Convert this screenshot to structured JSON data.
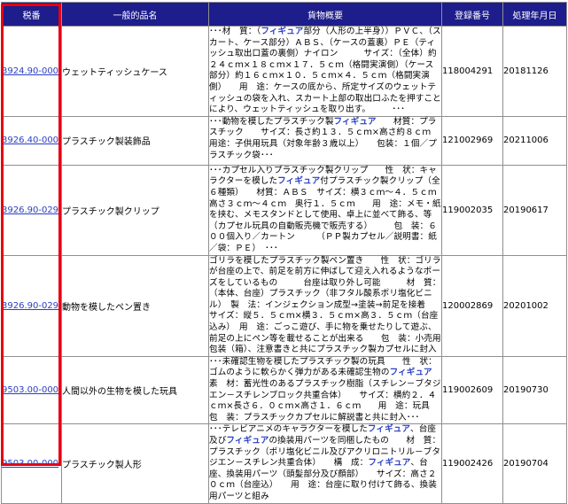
{
  "headers": {
    "tariff": "税番",
    "name": "一般的品名",
    "desc": "貨物概要",
    "reg": "登録番号",
    "date": "処理年月日"
  },
  "rows": [
    {
      "tariff": "3924.90-000",
      "name": "ウェットティッシュケース",
      "desc": [
        {
          "t": "･･･材　質：（"
        },
        {
          "t": "フィギュア",
          "k": 1
        },
        {
          "t": "部分（人形の上半身））ＰＶＣ、（スカート、ケース部分）ＡＢＳ、（ケースの蓋裏）ＰＥ（ティッシュ取出口蓋の裏側）ナイロン　　　サイズ：（全体）約２４ｃｍ×１８ｃｍ×１７．５ｃｍ（格闘実演側）（ケース部分）約１６ｃｍ×１０．５ｃｍ×４．５ｃｍ（格闘実演側）　　用　途：ケースの底から、所定サイズのウェットティッシュの袋を入れ、スカート上部の取出口ふたを押すことにより、ウェットティッシュを取り出す。　　　･･･"
        }
      ],
      "reg": "118004291",
      "date": "20181126"
    },
    {
      "tariff": "3926.40-000",
      "name": "プラスチック製装飾品",
      "desc": [
        {
          "t": "･･･動物を模したプラスチック製"
        },
        {
          "t": "フィギュア",
          "k": 1
        },
        {
          "t": "　　材質：プラスチック　　サイズ：長さ約１３．５ｃｍ×高さ約８ｃｍ　　用途：子供用玩具（対象年齢３歳以上）　　包装：１個／プラスチック袋･･･"
        }
      ],
      "reg": "121002969",
      "date": "20211006"
    },
    {
      "tariff": "3926.90-029",
      "name": "プラスチック製クリップ",
      "desc": [
        {
          "t": "･･･カプセル入りプラスチック製クリップ　　性　状：キャラクターを模した"
        },
        {
          "t": "フィギュア",
          "k": 1
        },
        {
          "t": "付プラスチック製クリップ（全６種類）　　材質：ＡＢＳ　サイズ：横３ｃｍ～４．５ｃｍ　高さ３ｃｍ～４ｃｍ　奥行１．５ｃｍ　　用　途：メモ・紙を挟む、メモスタンドとして使用、卓上に並べて飾る、等　　　　（カプセル玩具の自動販売機で販売する）　　　包　装：６００個入り／カートン　　　（ＰＰ製カプセル／説明書：紙／袋：ＰＥ）　･･･"
        }
      ],
      "reg": "119002035",
      "date": "20190617"
    },
    {
      "tariff": "3926.90-029",
      "name": "動物を模したペン置き",
      "desc": [
        {
          "t": "ゴリラを模したプラスチック製ペン置き　　性　状：ゴリラが台座の上で、前足を前方に伸ばして迎え入れるようなポーズをしているもの　　　台座は取り外し可能　　　材　質：（本体、台座）プラスチック（非フタル酸系ポリ塩化ビニル）　製　法：インジェクション成型→塗装→前足を接着　　サイズ：縦５．５ｃｍ×横３．５ｃｍ×高３．５ｃｍ（台座込み）　用　途：ごっこ遊び、手に物を乗せたりして遊ぶ、前足の上にペン等を載せることが出来る　　包　装：小売用包装（箱）、注意書きと共にプラスチック製カプセルに封入"
        }
      ],
      "reg": "120002869",
      "date": "20201002"
    },
    {
      "tariff": "9503.00-000",
      "name": "人間以外の生物を模した玩具",
      "desc": [
        {
          "t": "･･･未確認生物を模したプラスチック製の玩具　　性　状：ゴムのように軟らかく弾力がある未確認生物の"
        },
        {
          "t": "フィギュア",
          "k": 1
        },
        {
          "t": "　　素　材：蓄光性のあるプラスチック樹脂（スチレン－ブタジエン－スチレンブロック共重合体）　　サイズ：横約２．４ｃｍ×長さ６．０ｃｍ×高さ１．６ｃｍ　　用　途：玩具　　包　装：プラスチックカプセルに解説書と共に封入･･･"
        }
      ],
      "reg": "119002609",
      "date": "20190730"
    },
    {
      "tariff": "9503.00-000",
      "name": "プラスチック製人形",
      "desc": [
        {
          "t": "･･･テレビアニメのキャラクターを模した"
        },
        {
          "t": "フィギュア",
          "k": 1
        },
        {
          "t": "、台座及び"
        },
        {
          "t": "フィギュア",
          "k": 1
        },
        {
          "t": "の換装用パーツを同梱したもの　　材　質：プラスチック（ポリ塩化ビニル及びアクリロニトリル－ブタジエン－スチレン共重合体）　　構　成："
        },
        {
          "t": "フィギュア",
          "k": 1
        },
        {
          "t": "、台座、換装用パーツ（頭髪部分及び顔部）　　サイズ：高さ２０ｃｍ（台座込）　　用　途：台座に取り付けて飾る、換装用パーツと組み"
        }
      ],
      "reg": "119002426",
      "date": "20190704"
    }
  ]
}
